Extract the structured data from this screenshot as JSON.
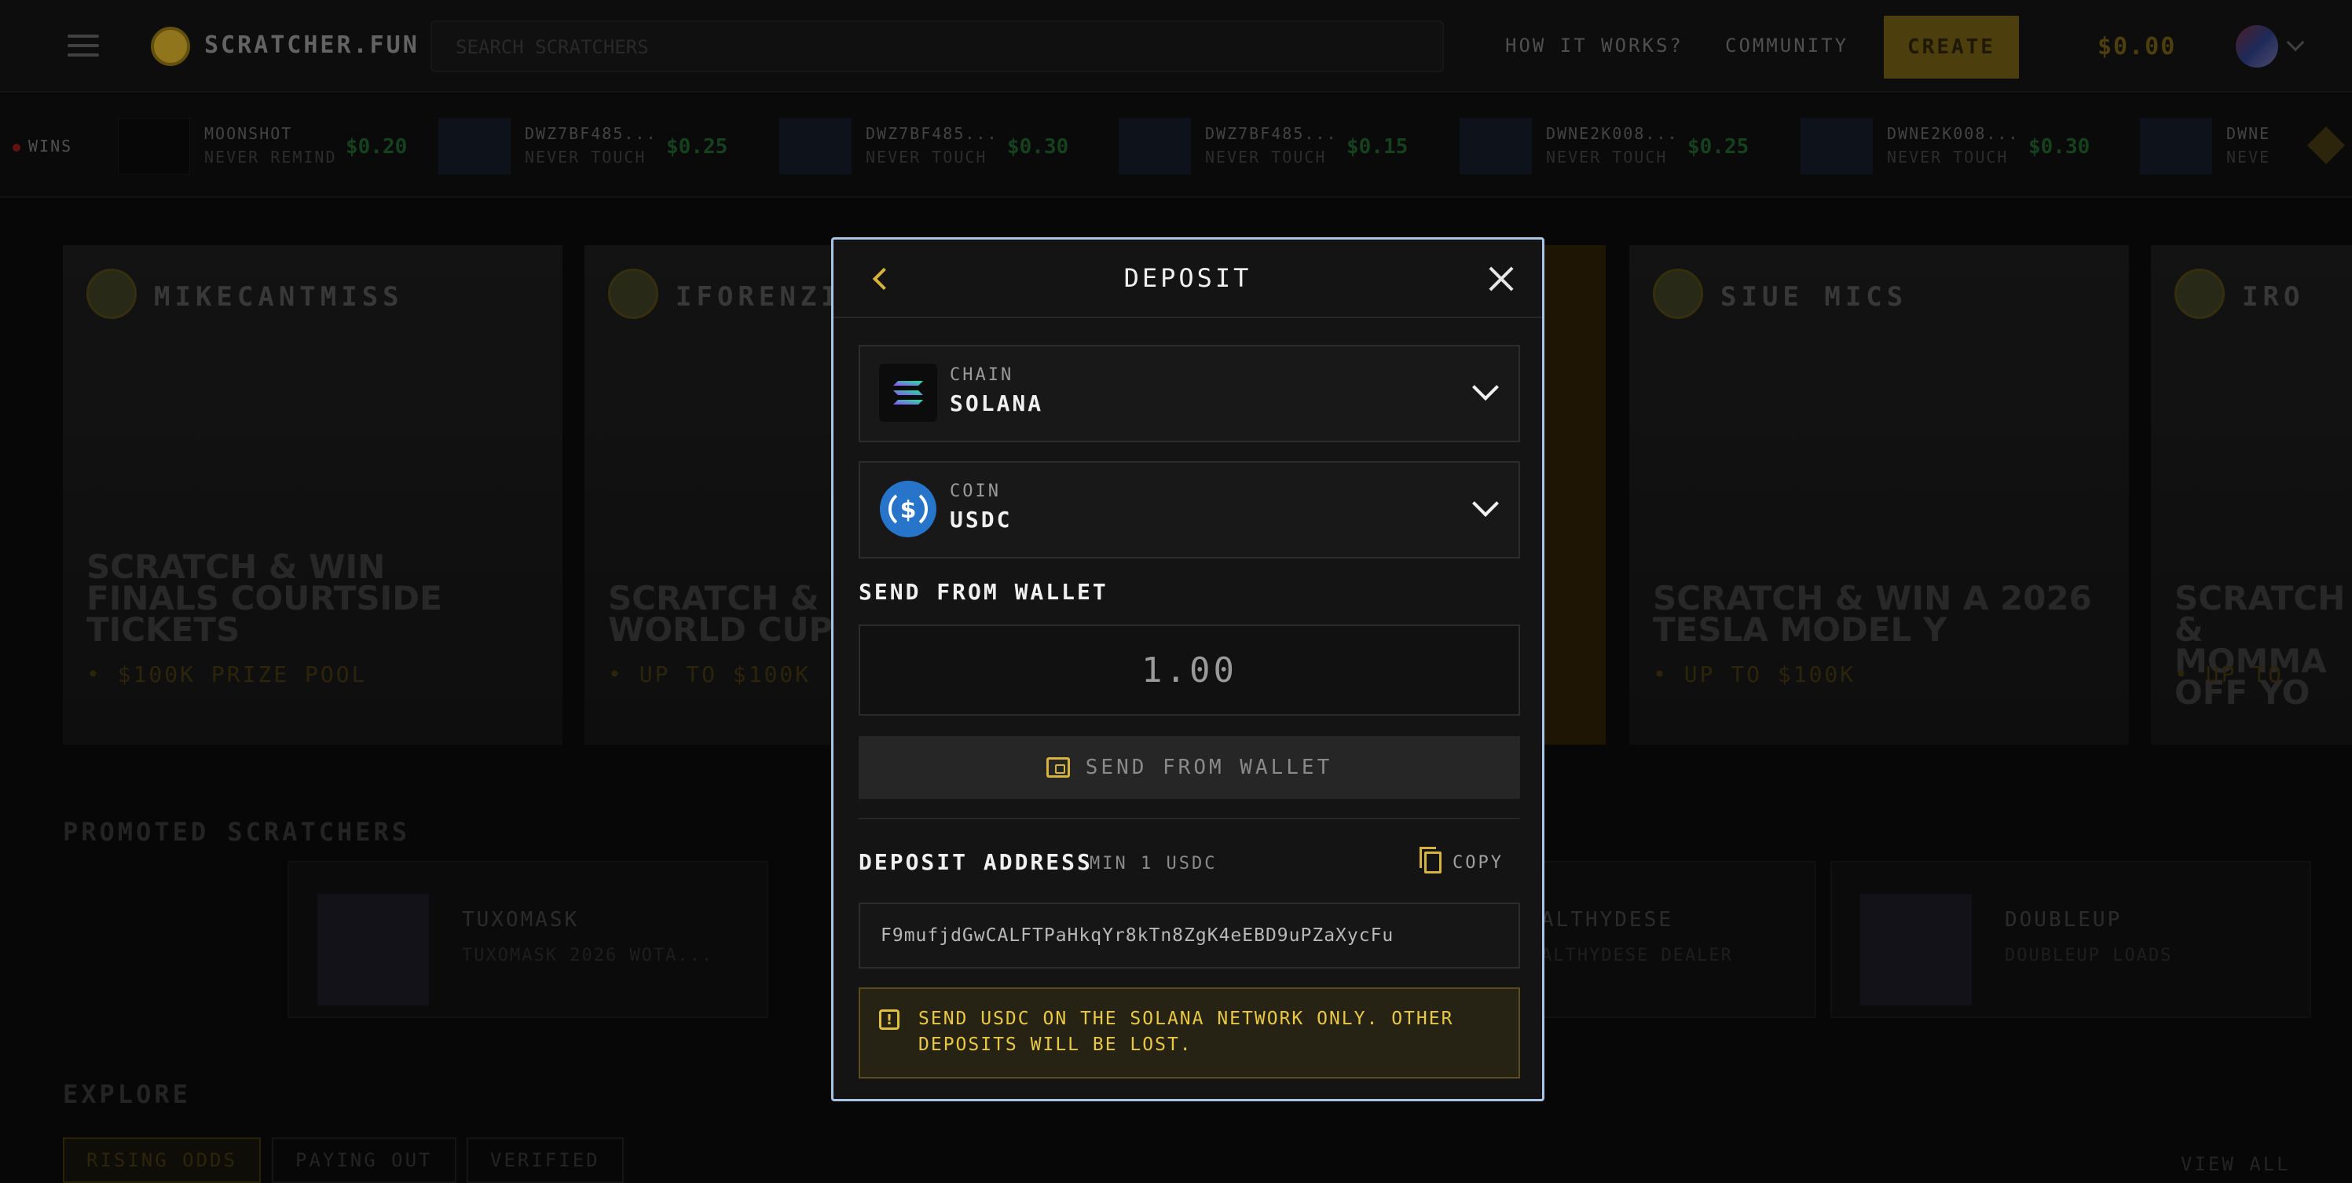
{
  "topbar": {
    "logo_text": "SCRATCHER.FUN",
    "search_placeholder": "SEARCH SCRATCHERS",
    "nav_how": "HOW IT WORKS?",
    "nav_community": "COMMUNITY",
    "create_label": "CREATE",
    "balance": "$0.00"
  },
  "ticker": {
    "label": "WINS",
    "items": [
      {
        "name": "MOONSHOT",
        "sub": "NEVER REMIND",
        "amount": "$0.20"
      },
      {
        "name": "DWZ7BF485...",
        "sub": "NEVER TOUCH",
        "amount": "$0.25"
      },
      {
        "name": "DWZ7BF485...",
        "sub": "NEVER TOUCH",
        "amount": "$0.30"
      },
      {
        "name": "DWZ7BF485...",
        "sub": "NEVER TOUCH",
        "amount": "$0.15"
      },
      {
        "name": "DWNE2K008...",
        "sub": "NEVER TOUCH",
        "amount": "$0.25"
      },
      {
        "name": "DWNE2K008...",
        "sub": "NEVER TOUCH",
        "amount": "$0.30"
      },
      {
        "name": "DWNE",
        "sub": "NEVE",
        "amount": ""
      }
    ]
  },
  "cards": [
    {
      "name": "MIKECANTMISS",
      "title": "SCRATCH & WIN FINALS COURTSIDE TICKETS",
      "prize": "• $100K PRIZE POOL"
    },
    {
      "name": "IFORENZI",
      "title": "SCRATCH & WIN WORLD CUP TICKETS",
      "prize": "• UP TO $100K"
    },
    {
      "name": "",
      "title": "",
      "prize": ""
    },
    {
      "name": "SIUE MICS",
      "title": "SCRATCH & WIN A 2026 TESLA MODEL Y",
      "prize": "• UP TO $100K"
    },
    {
      "name": "IRO",
      "title": "SCRATCH & MOMMA OFF YO",
      "prize": "• UP TO"
    }
  ],
  "promoted": {
    "title": "PROMOTED SCRATCHERS",
    "items": [
      {
        "name": "TUXOMASK",
        "sub": "TUXOMASK 2026 WOTA..."
      },
      {
        "name": "ALTHYDESE",
        "sub": "ALTHYDESE DEALER"
      },
      {
        "name": "DOUBLEUP",
        "sub": "DOUBLEUP LOADS"
      }
    ]
  },
  "explore": {
    "title": "EXPLORE",
    "chips": [
      "RISING ODDS",
      "PAYING OUT",
      "VERIFIED"
    ],
    "view_all": "VIEW ALL"
  },
  "modal": {
    "title": "DEPOSIT",
    "chain": {
      "label": "CHAIN",
      "value": "SOLANA",
      "icon": "solana-icon"
    },
    "coin": {
      "label": "COIN",
      "value": "USDC",
      "icon": "usdc-icon"
    },
    "send_title": "SEND FROM WALLET",
    "amount": "1.00",
    "send_button": "SEND FROM WALLET",
    "address_title": "DEPOSIT ADDRESS",
    "address_min": "MIN 1 USDC",
    "copy_label": "COPY",
    "address": "F9mufjdGwCALFTPaHkqYr8kTn8ZgK4eEBD9uPZaXycFu",
    "warning": "SEND USDC ON THE SOLANA NETWORK ONLY. OTHER DEPOSITS WILL BE LOST.",
    "warning_icon": "!"
  },
  "colors": {
    "accent": "#d6b43c",
    "modal_border": "#a8c4e6",
    "warning_text": "#e8c844",
    "usdc_blue": "#2775ca"
  }
}
